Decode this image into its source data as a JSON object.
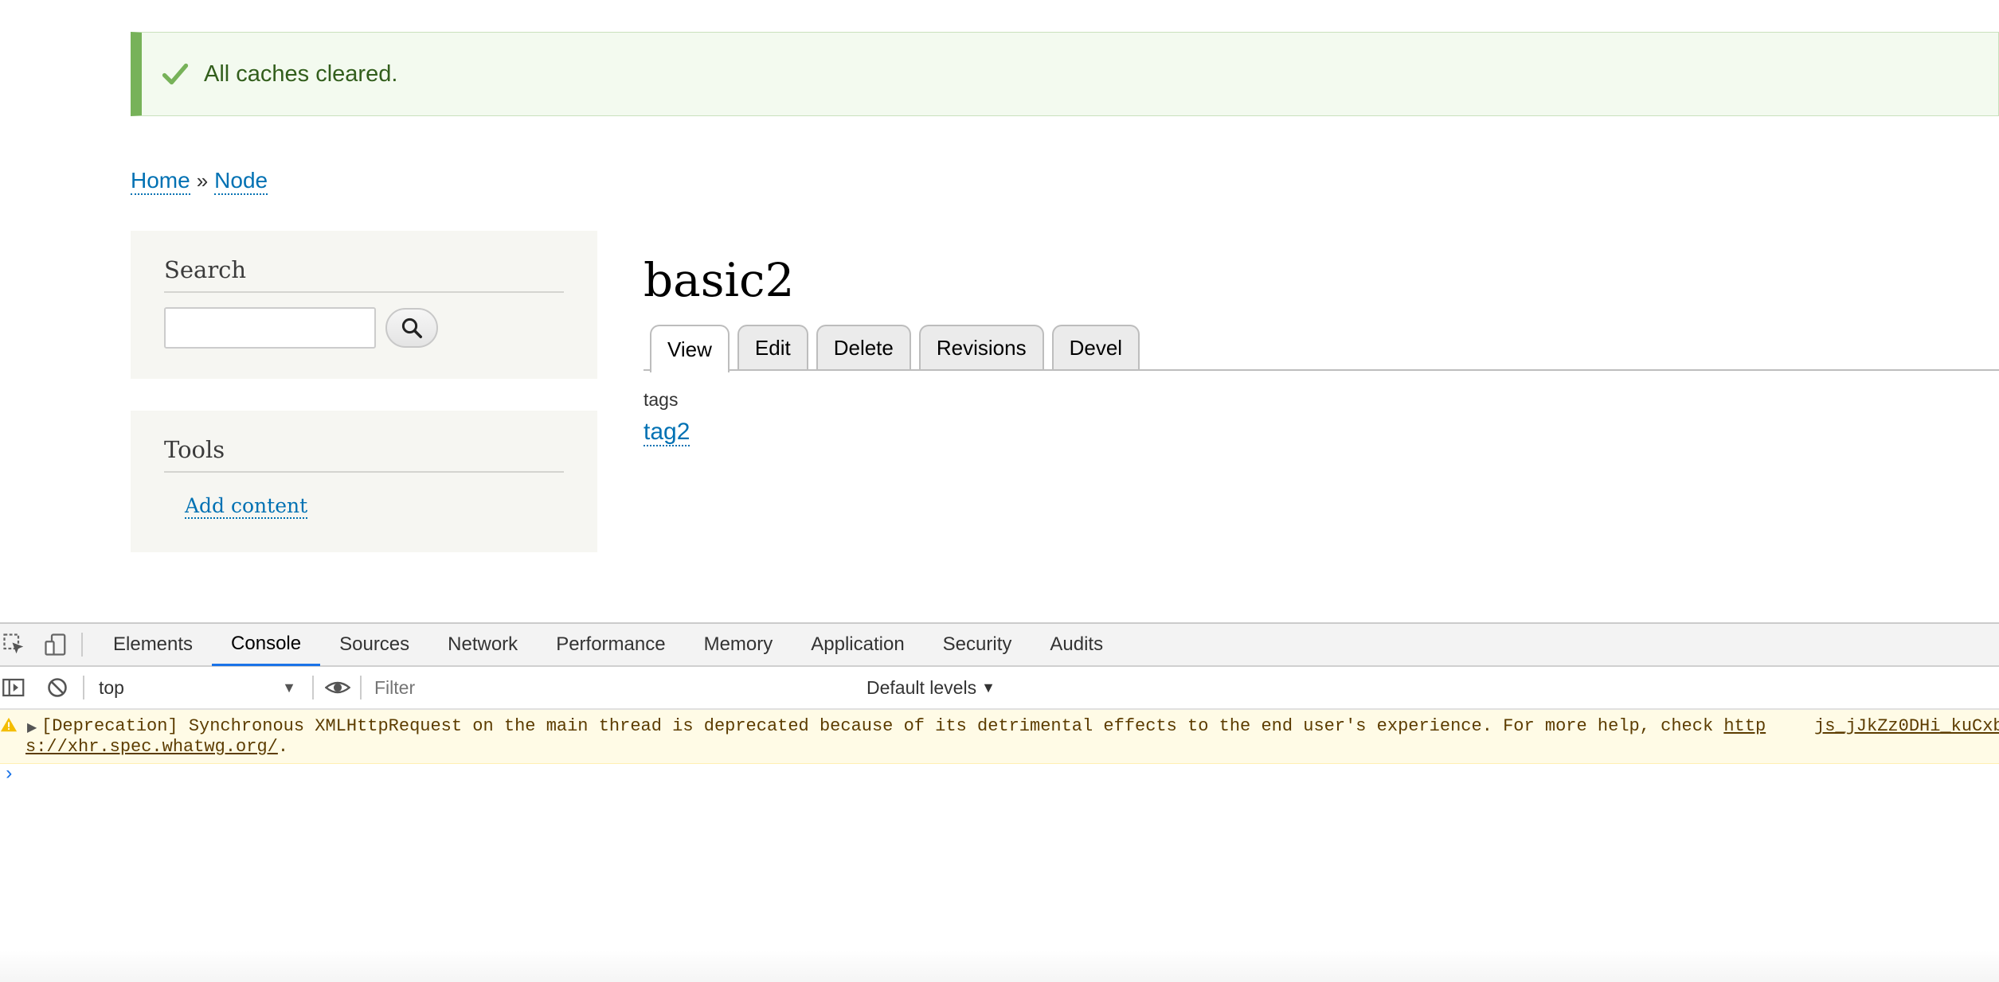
{
  "status": {
    "message": "All caches cleared.",
    "icon": "check-icon",
    "accent": "#77b259"
  },
  "breadcrumb": {
    "home": "Home",
    "separator": "»",
    "node": "Node"
  },
  "search_block": {
    "title": "Search",
    "button_icon": "search-icon"
  },
  "tools_block": {
    "title": "Tools",
    "link": "Add content"
  },
  "node": {
    "title": "basic2",
    "tabs": [
      "View",
      "Edit",
      "Delete",
      "Revisions",
      "Devel"
    ],
    "active_tab": "View",
    "field_label": "tags",
    "field_value": "tag2"
  },
  "devtools": {
    "tabs": [
      "Elements",
      "Console",
      "Sources",
      "Network",
      "Performance",
      "Memory",
      "Application",
      "Security",
      "Audits"
    ],
    "active_tab": "Console",
    "context": "top",
    "filter_placeholder": "Filter",
    "levels": "Default levels",
    "warning": {
      "prefix": "[Deprecation] Synchronous XMLHttpRequest on the main thread is deprecated because of its detrimental effects to the end user's experience. For more help, check ",
      "link_part1": "http",
      "link_part2": "s://xhr.spec.whatwg.org/",
      "suffix": ".",
      "source": "js_jJkZz0DHi_kuCxb"
    },
    "prompt": "›"
  },
  "colors": {
    "link": "#0071b3",
    "devtools_accent": "#1a73e8",
    "warning_bg": "#fffbe6"
  }
}
